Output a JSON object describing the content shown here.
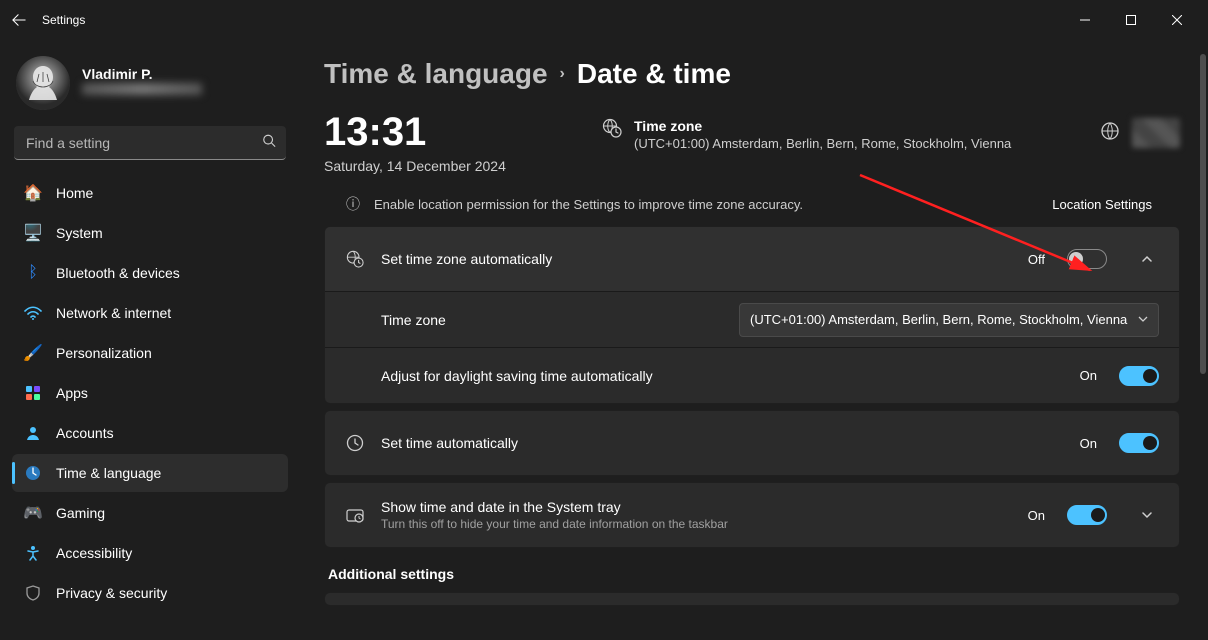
{
  "app": {
    "title": "Settings"
  },
  "user": {
    "name": "Vladimir P.",
    "email": "redacted"
  },
  "search": {
    "placeholder": "Find a setting"
  },
  "nav": {
    "items": [
      {
        "label": "Home"
      },
      {
        "label": "System"
      },
      {
        "label": "Bluetooth & devices"
      },
      {
        "label": "Network & internet"
      },
      {
        "label": "Personalization"
      },
      {
        "label": "Apps"
      },
      {
        "label": "Accounts"
      },
      {
        "label": "Time & language"
      },
      {
        "label": "Gaming"
      },
      {
        "label": "Accessibility"
      },
      {
        "label": "Privacy & security"
      }
    ],
    "selected_index": 7
  },
  "breadcrumb": {
    "parent": "Time & language",
    "current": "Date & time"
  },
  "clock": {
    "time": "13:31",
    "date": "Saturday, 14 December 2024"
  },
  "timezone_header": {
    "label": "Time zone",
    "value": "(UTC+01:00) Amsterdam, Berlin, Bern, Rome, Stockholm, Vienna"
  },
  "banner": {
    "text": "Enable location permission for the Settings to improve time zone accuracy.",
    "link": "Location Settings"
  },
  "rows": {
    "auto_tz": {
      "title": "Set time zone automatically",
      "state": "Off"
    },
    "tz_select": {
      "label": "Time zone",
      "value": "(UTC+01:00) Amsterdam, Berlin, Bern, Rome, Stockholm, Vienna"
    },
    "dst": {
      "title": "Adjust for daylight saving time automatically",
      "state": "On"
    },
    "auto_time": {
      "title": "Set time automatically",
      "state": "On"
    },
    "systray": {
      "title": "Show time and date in the System tray",
      "sub": "Turn this off to hide your time and date information on the taskbar",
      "state": "On"
    }
  },
  "section": {
    "additional": "Additional settings"
  },
  "colors": {
    "accent": "#4cc2ff",
    "annotation": "#ff2020"
  }
}
